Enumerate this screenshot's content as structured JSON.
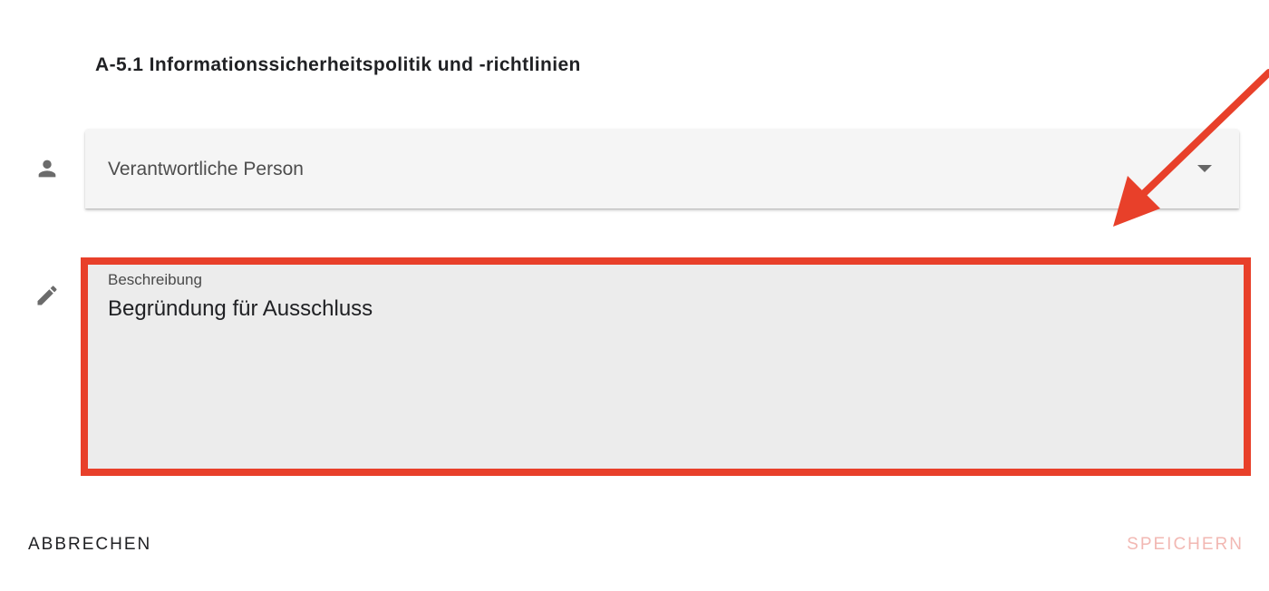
{
  "dialog": {
    "title": "A-5.1 Informationssicherheitspolitik und -richtlinien"
  },
  "fields": {
    "responsible_person": {
      "icon": "person-icon",
      "placeholder": "Verantwortliche Person"
    },
    "description": {
      "icon": "pencil-icon",
      "label": "Beschreibung",
      "value": "Begründung für Ausschluss"
    }
  },
  "actions": {
    "cancel_label": "ABBRECHEN",
    "save_label": "SPEICHERN"
  },
  "colors": {
    "highlight": "#e8402a",
    "save_disabled": "#f2b8b3",
    "field_background": "#ececec",
    "select_background": "#f5f5f5"
  }
}
